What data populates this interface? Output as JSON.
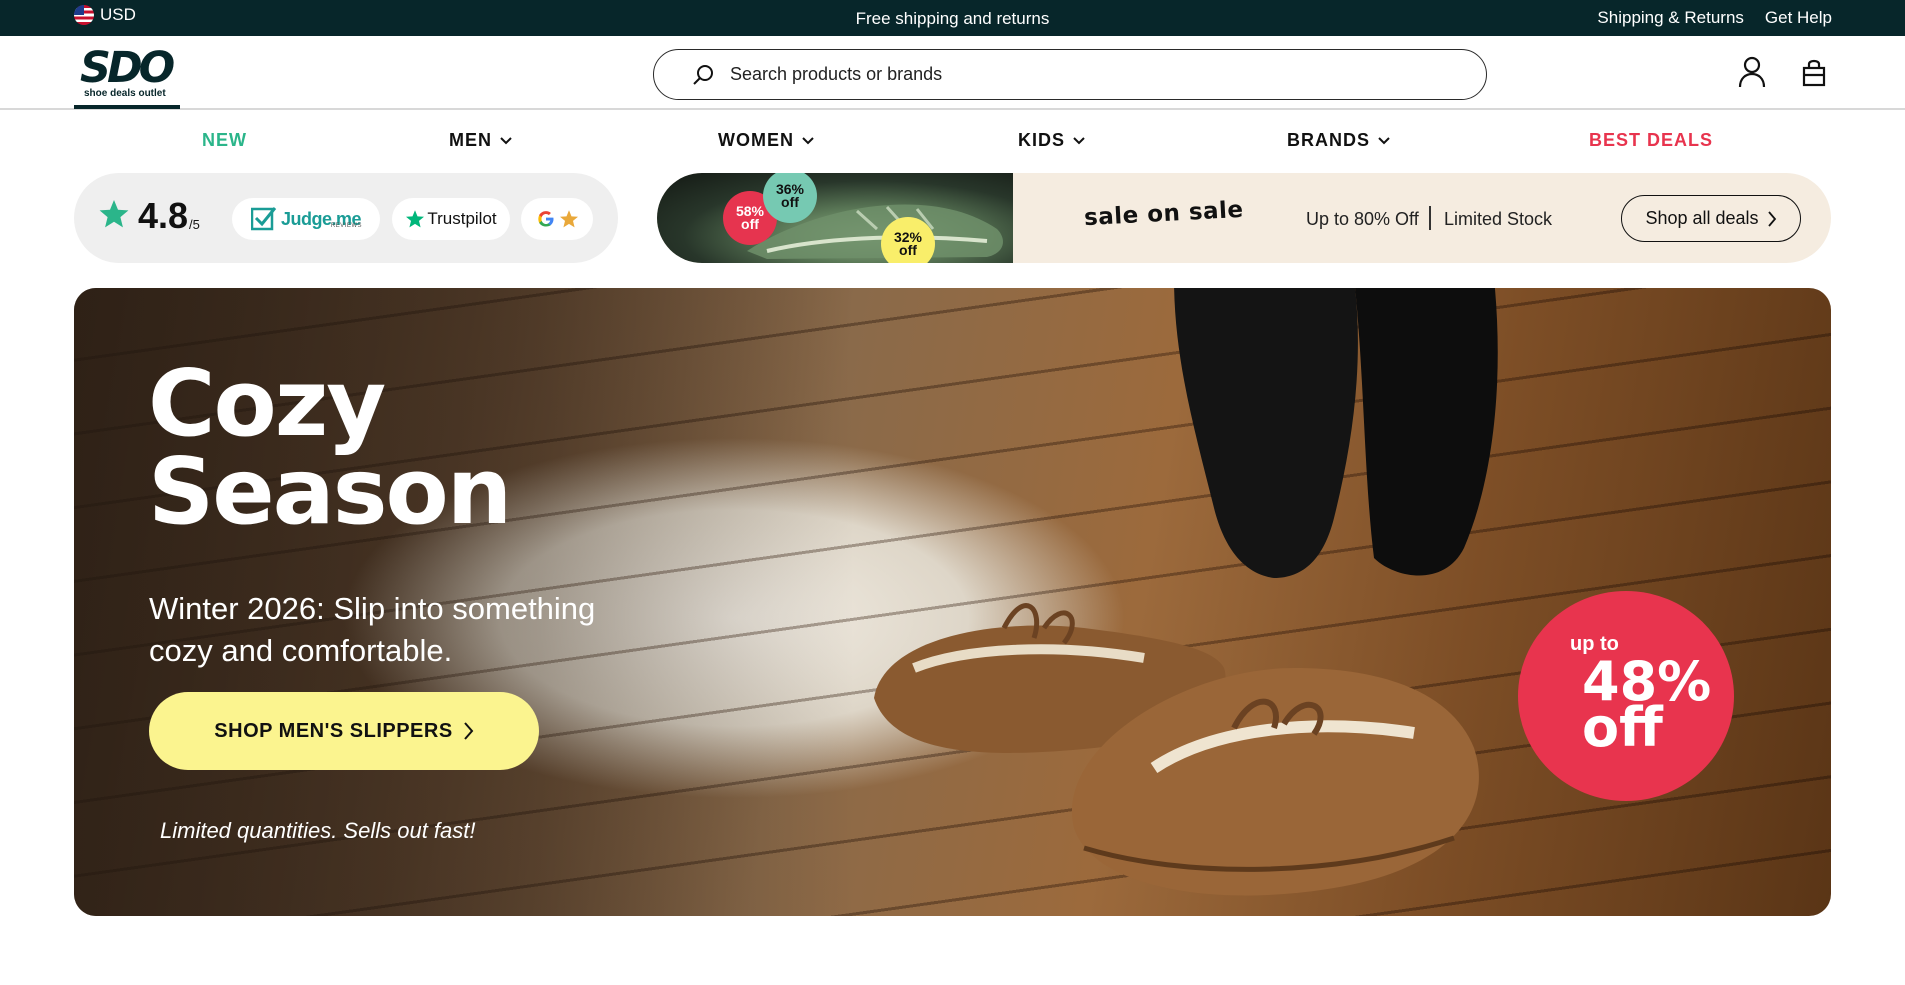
{
  "topbar": {
    "currency": "USD",
    "promo": "Free shipping and returns",
    "links": [
      "Shipping & Returns",
      "Get Help"
    ]
  },
  "header": {
    "logo_mark": "SDO",
    "logo_tagline": "shoe deals outlet",
    "search_placeholder": "Search products or brands",
    "icons": [
      "search-icon",
      "account-icon",
      "bag-icon"
    ]
  },
  "nav": {
    "items": [
      {
        "label": "NEW",
        "color": "#2bb58a",
        "dropdown": false
      },
      {
        "label": "MEN",
        "color": "#111111",
        "dropdown": true
      },
      {
        "label": "WOMEN",
        "color": "#111111",
        "dropdown": true
      },
      {
        "label": "KIDS",
        "color": "#111111",
        "dropdown": true
      },
      {
        "label": "BRANDS",
        "color": "#111111",
        "dropdown": true
      },
      {
        "label": "BEST DEALS",
        "color": "#e8344e",
        "dropdown": false
      }
    ]
  },
  "reviews": {
    "rating": "4.8",
    "scale": "/5",
    "star_color": "#2bb58a",
    "badges": {
      "judgeme": "Judge.me",
      "judgeme_sub": "REVIEWS",
      "trustpilot": "Trustpilot"
    }
  },
  "sale_banner": {
    "bubbles": [
      {
        "pct": "58%",
        "word": "off",
        "color": "#e6344f"
      },
      {
        "pct": "36%",
        "word": "off",
        "color": "#76c9b2"
      },
      {
        "pct": "32%",
        "word": "off",
        "color": "#f9ee6a"
      }
    ],
    "headline": "sale on sale",
    "offer": "Up to 80% Off",
    "stock": "Limited Stock",
    "cta": "Shop all deals"
  },
  "hero": {
    "title": "Cozy\nSeason",
    "subtitle": "Winter 2026: Slip into something cozy and comfortable.",
    "cta": "SHOP MEN'S SLIPPERS",
    "note": "Limited quantities. Sells out fast!",
    "discount": {
      "upto": "up to",
      "value": "48%\noff",
      "color": "#e8344e"
    }
  }
}
